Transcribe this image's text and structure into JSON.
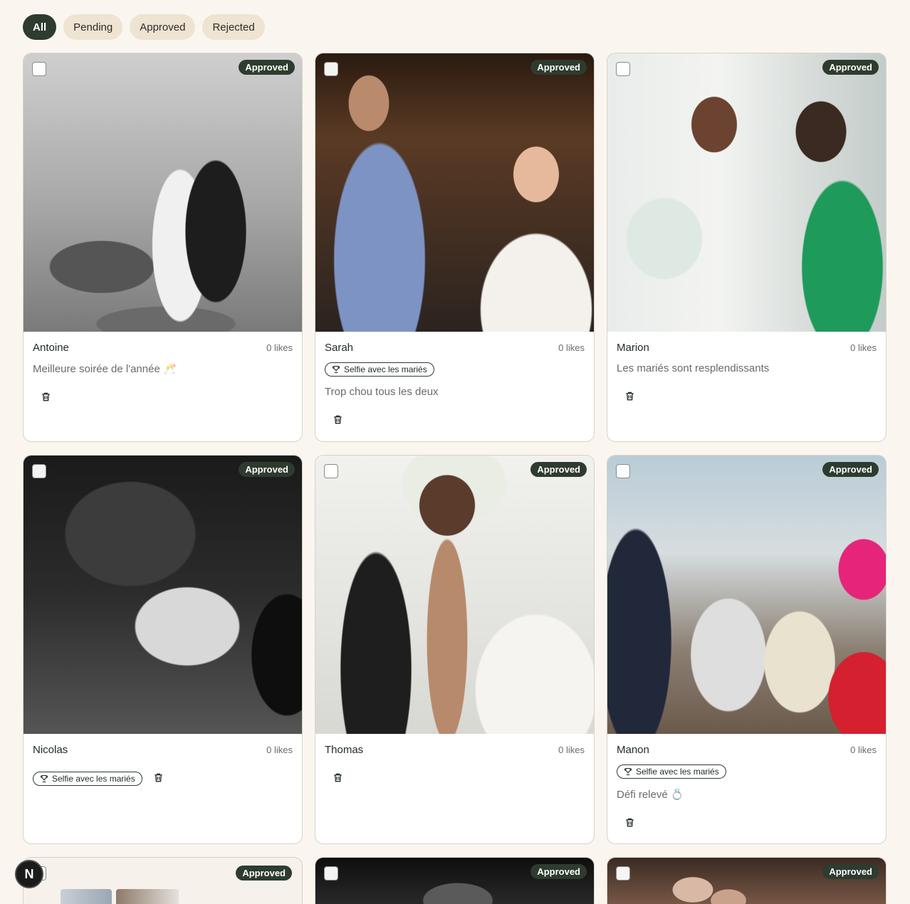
{
  "filters": [
    {
      "label": "All",
      "active": true
    },
    {
      "label": "Pending",
      "active": false
    },
    {
      "label": "Approved",
      "active": false
    },
    {
      "label": "Rejected",
      "active": false
    }
  ],
  "status_label": "Approved",
  "tag_label": "Selfie avec les mariés",
  "cards": [
    {
      "author": "Antoine",
      "likes": "0 likes",
      "caption": "Meilleure soirée de l'année 🥂"
    },
    {
      "author": "Sarah",
      "likes": "0 likes",
      "caption": "Trop chou tous les deux"
    },
    {
      "author": "Marion",
      "likes": "0 likes",
      "caption": "Les mariés sont resplendissants"
    },
    {
      "author": "Nicolas",
      "likes": "0 likes",
      "caption": ""
    },
    {
      "author": "Thomas",
      "likes": "0 likes",
      "caption": ""
    },
    {
      "author": "Manon",
      "likes": "0 likes",
      "caption": "Défi relevé 💍"
    }
  ],
  "fab_label": "N",
  "colors": {
    "accent": "#2e3b2f",
    "chip": "#efe3d2",
    "background": "#faf6ef"
  }
}
